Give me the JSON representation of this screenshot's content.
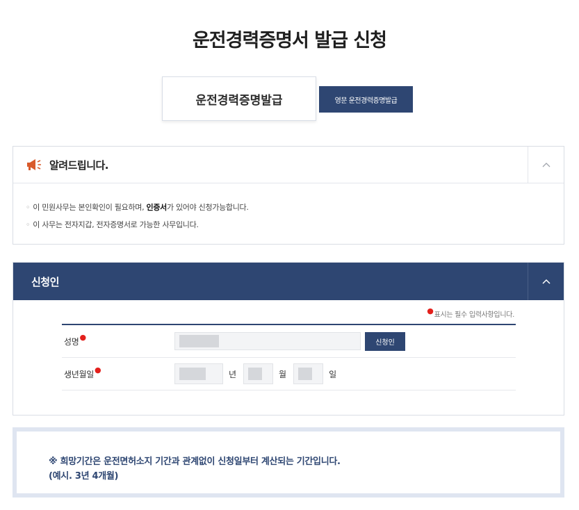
{
  "page": {
    "title": "운전경력증명서 발급 신청"
  },
  "tabs": {
    "main_label": "운전경력증명발급",
    "english_label": "영문 운전경력증명발급"
  },
  "notice": {
    "title": "알려드립니다.",
    "line1_pre": "이 민원사무는 본인확인이 필요하며, ",
    "line1_bold": "인증서",
    "line1_post": "가 있어야 신청가능합니다.",
    "line2": "이 사무는 전자지갑, 전자증명서로 가능한 사무입니다.",
    "toggle_icon": "chevron-up-icon"
  },
  "applicant": {
    "title": "신청인",
    "required_note": "표시는 필수 입력사항입니다.",
    "name_label": "성명",
    "applicant_button": "신청인",
    "birth_label": "생년월일",
    "year_unit": "년",
    "month_unit": "월",
    "day_unit": "일"
  },
  "info": {
    "line1": "※ 희망기간은 운전면허소지 기간과 관계없이 신청일부터 계산되는 기간입니다.",
    "line2": "(예시. 3년 4개월)"
  },
  "colors": {
    "navy": "#2e4672",
    "required_dot": "#e3201c",
    "info_border": "#dfe5f1",
    "megaphone": "#d95a2b"
  }
}
